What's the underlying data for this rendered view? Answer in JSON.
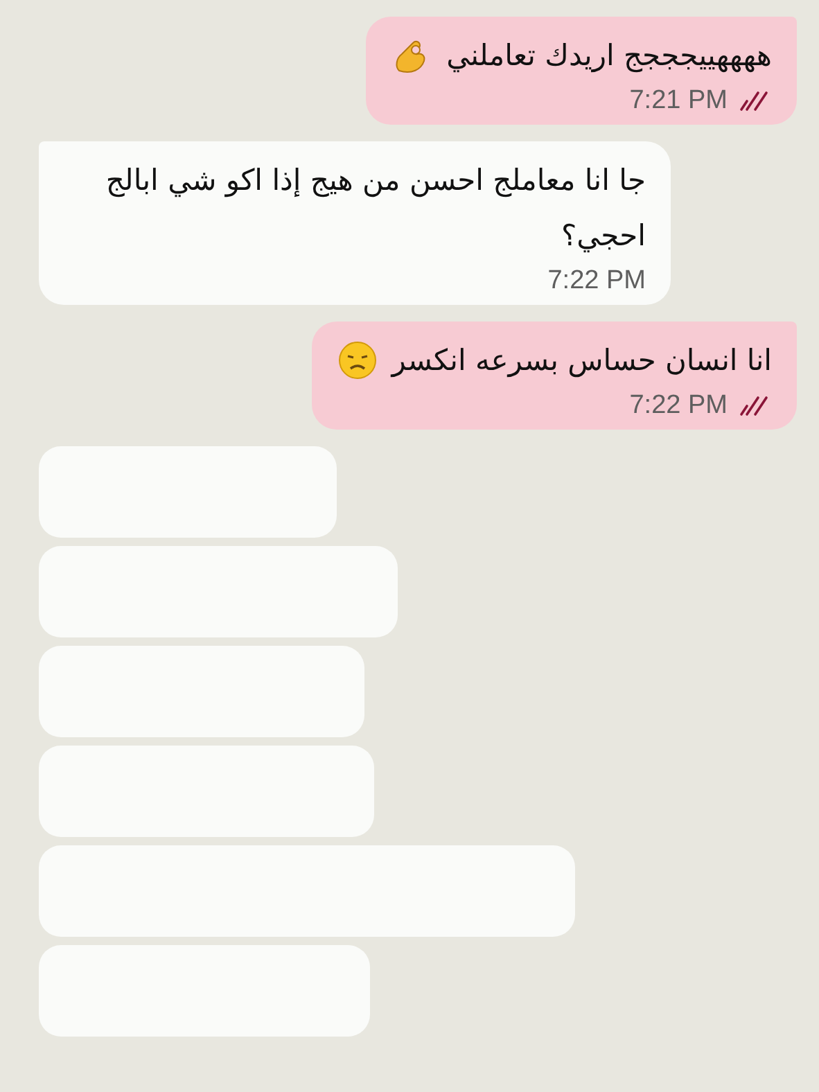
{
  "messages": [
    {
      "kind": "sent",
      "text": "ههههييجججج اريدك تعاملني",
      "emoji": {
        "kind": "ok_hand"
      },
      "time": "7:21 PM",
      "read": true
    },
    {
      "kind": "received",
      "text": "جا انا معاملج احسن من هيج إذا اكو شي ابالج احجي؟",
      "time": "7:22 PM"
    },
    {
      "kind": "sent",
      "text": "انا انسان حساس بسرعه انكسر",
      "emoji": {
        "kind": "sad"
      },
      "time": "7:22 PM",
      "read": true
    },
    {
      "kind": "blank"
    },
    {
      "kind": "blank"
    },
    {
      "kind": "blank"
    },
    {
      "kind": "blank"
    },
    {
      "kind": "blank"
    },
    {
      "kind": "blank"
    }
  ]
}
